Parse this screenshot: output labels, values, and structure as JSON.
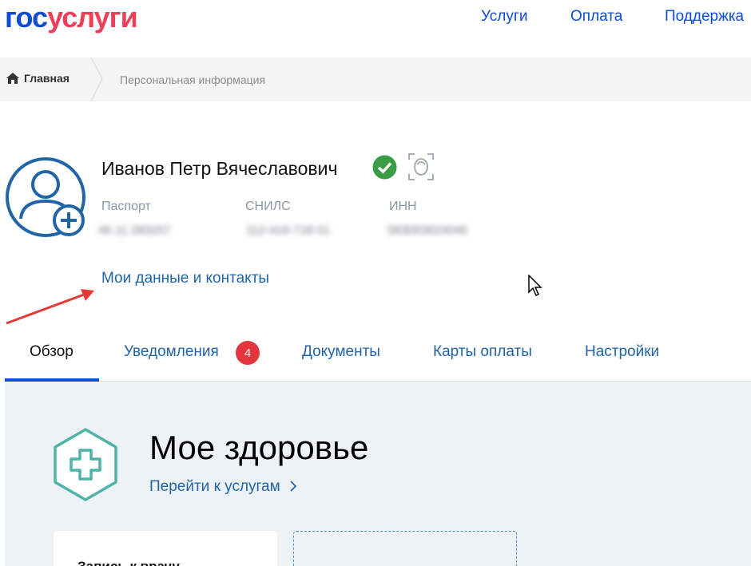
{
  "logo": {
    "part1": "гос",
    "part2": "услуги"
  },
  "nav": [
    {
      "label": "Услуги"
    },
    {
      "label": "Оплата"
    },
    {
      "label": "Поддержка"
    }
  ],
  "breadcrumb": {
    "home": "Главная",
    "current": "Персональная информация"
  },
  "profile": {
    "name": "Иванов Петр Вячеславович",
    "passport_label": "Паспорт",
    "passport_value": "46 11 283257",
    "snils_label": "СНИЛС",
    "snils_value": "112-416-718 01",
    "inn_label": "ИНН",
    "inn_value": "583093624046",
    "my_data_link": "Мои данные и контакты"
  },
  "tabs": [
    {
      "label": "Обзор",
      "active": true
    },
    {
      "label": "Уведомления",
      "badge": "4"
    },
    {
      "label": "Документы"
    },
    {
      "label": "Карты оплаты"
    },
    {
      "label": "Настройки"
    }
  ],
  "health": {
    "title": "Мое здоровье",
    "link": "Перейти к услугам",
    "card1_title": "Запись к врачу"
  },
  "colors": {
    "brand_blue": "#0d4cd3",
    "brand_red": "#ee3f58",
    "link": "#2165a6",
    "badge": "#e1363d",
    "verified": "#3a9c44",
    "health_bg": "#edf2f6"
  }
}
